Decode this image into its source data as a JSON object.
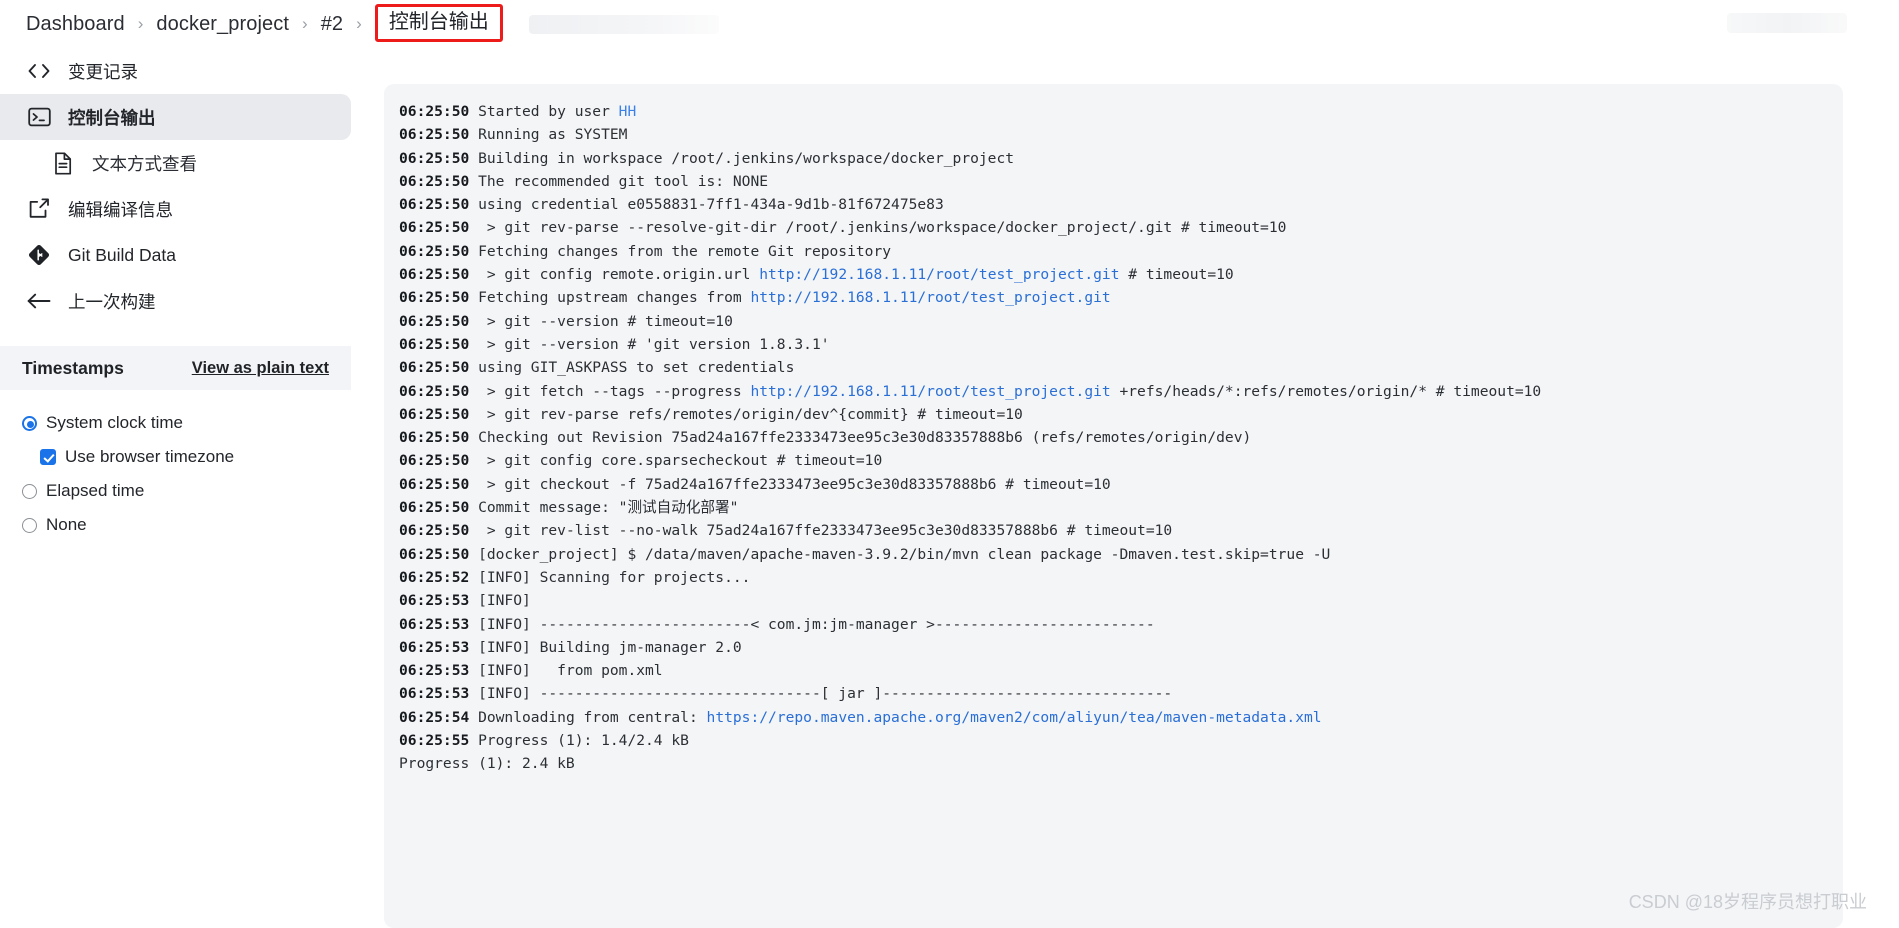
{
  "breadcrumb": {
    "items": [
      {
        "label": "Dashboard",
        "name": "breadcrumb-dashboard"
      },
      {
        "label": "docker_project",
        "name": "breadcrumb-docker-project"
      },
      {
        "label": "#2",
        "name": "breadcrumb-build-number"
      }
    ],
    "separator": "›",
    "current": "控制台输出"
  },
  "sidebar": {
    "items": [
      {
        "label": "变更记录",
        "icon": "code-icon",
        "name": "sidebar-item-changes",
        "active": false,
        "indent": false
      },
      {
        "label": "控制台输出",
        "icon": "terminal-icon",
        "name": "sidebar-item-console-output",
        "active": true,
        "indent": false
      },
      {
        "label": "文本方式查看",
        "icon": "document-icon",
        "name": "sidebar-item-view-as-plain-text",
        "active": false,
        "indent": true
      },
      {
        "label": "编辑编译信息",
        "icon": "edit-icon",
        "name": "sidebar-item-edit-build-information",
        "active": false,
        "indent": false
      },
      {
        "label": "Git Build Data",
        "icon": "git-icon",
        "name": "sidebar-item-git-build-data",
        "active": false,
        "indent": false
      },
      {
        "label": "上一次构建",
        "icon": "arrow-left-icon",
        "name": "sidebar-item-previous-build",
        "active": false,
        "indent": false
      }
    ]
  },
  "timestamps": {
    "title": "Timestamps",
    "view_plain_text_link": "View as plain text",
    "options": [
      {
        "label": "System clock time",
        "type": "radio",
        "checked": true,
        "sub": false,
        "name": "radio-system-clock-time"
      },
      {
        "label": "Use browser timezone",
        "type": "checkbox",
        "checked": true,
        "sub": true,
        "name": "checkbox-use-browser-timezone"
      },
      {
        "label": "Elapsed time",
        "type": "radio",
        "checked": false,
        "sub": false,
        "name": "radio-elapsed-time"
      },
      {
        "label": "None",
        "type": "radio",
        "checked": false,
        "sub": false,
        "name": "radio-none"
      }
    ]
  },
  "console": {
    "lines": [
      {
        "time": "06:25:50",
        "parts": [
          {
            "t": "Started by user "
          },
          {
            "t": "HH",
            "c": "usr"
          }
        ]
      },
      {
        "time": "06:25:50",
        "parts": [
          {
            "t": "Running as SYSTEM"
          }
        ]
      },
      {
        "time": "06:25:50",
        "parts": [
          {
            "t": "Building in workspace /root/.jenkins/workspace/docker_project"
          }
        ]
      },
      {
        "time": "06:25:50",
        "parts": [
          {
            "t": "The recommended git tool is: NONE"
          }
        ]
      },
      {
        "time": "06:25:50",
        "parts": [
          {
            "t": "using credential e0558831-7ff1-434a-9d1b-81f672475e83"
          }
        ]
      },
      {
        "time": "06:25:50",
        "parts": [
          {
            "t": " > git rev-parse --resolve-git-dir /root/.jenkins/workspace/docker_project/.git # timeout=10"
          }
        ]
      },
      {
        "time": "06:25:50",
        "parts": [
          {
            "t": "Fetching changes from the remote Git repository"
          }
        ]
      },
      {
        "time": "06:25:50",
        "parts": [
          {
            "t": " > git config remote.origin.url "
          },
          {
            "t": "http://192.168.1.11/root/test_project.git",
            "c": "lnk"
          },
          {
            "t": " # timeout=10"
          }
        ]
      },
      {
        "time": "06:25:50",
        "parts": [
          {
            "t": "Fetching upstream changes from "
          },
          {
            "t": "http://192.168.1.11/root/test_project.git",
            "c": "lnk"
          }
        ]
      },
      {
        "time": "06:25:50",
        "parts": [
          {
            "t": " > git --version # timeout=10"
          }
        ]
      },
      {
        "time": "06:25:50",
        "parts": [
          {
            "t": " > git --version # 'git version 1.8.3.1'"
          }
        ]
      },
      {
        "time": "06:25:50",
        "parts": [
          {
            "t": "using GIT_ASKPASS to set credentials"
          }
        ]
      },
      {
        "time": "06:25:50",
        "parts": [
          {
            "t": " > git fetch --tags --progress "
          },
          {
            "t": "http://192.168.1.11/root/test_project.git",
            "c": "lnk"
          },
          {
            "t": " +refs/heads/*:refs/remotes/origin/* # timeout=10"
          }
        ]
      },
      {
        "time": "06:25:50",
        "parts": [
          {
            "t": " > git rev-parse refs/remotes/origin/dev^{commit} # timeout=10"
          }
        ]
      },
      {
        "time": "06:25:50",
        "parts": [
          {
            "t": "Checking out Revision 75ad24a167ffe2333473ee95c3e30d83357888b6 (refs/remotes/origin/dev)"
          }
        ]
      },
      {
        "time": "06:25:50",
        "parts": [
          {
            "t": " > git config core.sparsecheckout # timeout=10"
          }
        ]
      },
      {
        "time": "06:25:50",
        "parts": [
          {
            "t": " > git checkout -f 75ad24a167ffe2333473ee95c3e30d83357888b6 # timeout=10"
          }
        ]
      },
      {
        "time": "06:25:50",
        "parts": [
          {
            "t": "Commit message: \"测试自动化部署\""
          }
        ]
      },
      {
        "time": "06:25:50",
        "parts": [
          {
            "t": " > git rev-list --no-walk 75ad24a167ffe2333473ee95c3e30d83357888b6 # timeout=10"
          }
        ]
      },
      {
        "time": "06:25:50",
        "parts": [
          {
            "t": "[docker_project] $ /data/maven/apache-maven-3.9.2/bin/mvn clean package -Dmaven.test.skip=true -U"
          }
        ]
      },
      {
        "time": "06:25:52",
        "parts": [
          {
            "t": "[INFO] Scanning for projects..."
          }
        ]
      },
      {
        "time": "06:25:53",
        "parts": [
          {
            "t": "[INFO]"
          }
        ]
      },
      {
        "time": "06:25:53",
        "parts": [
          {
            "t": "[INFO] ------------------------< com.jm:jm-manager >-------------------------"
          }
        ]
      },
      {
        "time": "06:25:53",
        "parts": [
          {
            "t": "[INFO] Building jm-manager 2.0"
          }
        ]
      },
      {
        "time": "06:25:53",
        "parts": [
          {
            "t": "[INFO]   from pom.xml"
          }
        ]
      },
      {
        "time": "06:25:53",
        "parts": [
          {
            "t": "[INFO] --------------------------------[ jar ]---------------------------------"
          }
        ]
      },
      {
        "time": "06:25:54",
        "parts": [
          {
            "t": "Downloading from central: "
          },
          {
            "t": "https://repo.maven.apache.org/maven2/com/aliyun/tea/maven-metadata.xml",
            "c": "lnk"
          }
        ]
      },
      {
        "time": "06:25:55",
        "parts": [
          {
            "t": "Progress (1): 1.4/2.4 kB"
          }
        ]
      },
      {
        "time": "",
        "parts": [
          {
            "t": "Progress (1): 2.4 kB"
          }
        ]
      }
    ]
  },
  "watermark": "CSDN @18岁程序员想打职业",
  "colors": {
    "accent_blue": "#1a73e8",
    "link_blue": "#2a6fd6",
    "highlight_red": "#ee1b1b",
    "console_bg": "#f4f5f7",
    "sidebar_active_bg": "#e9eaee"
  }
}
